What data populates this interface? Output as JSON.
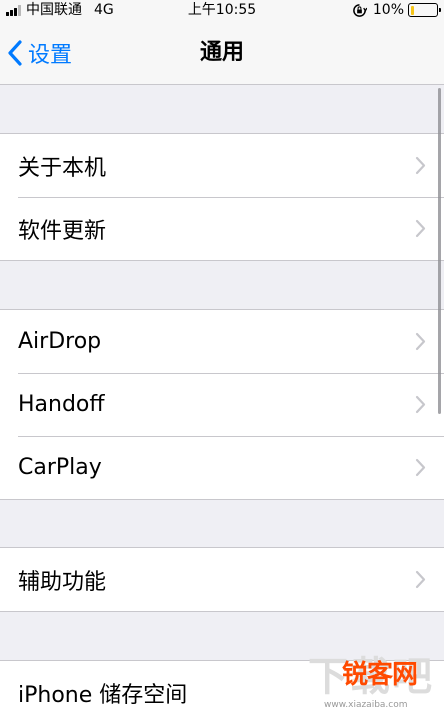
{
  "status_bar": {
    "carrier": "中国联通",
    "network": "4G",
    "time": "上午10:55",
    "battery": "10%",
    "battery_level": 0.1,
    "battery_color": "#f5c518"
  },
  "nav": {
    "back_label": "设置",
    "title": "通用",
    "accent": "#007aff"
  },
  "groups": [
    {
      "items": [
        {
          "label": "关于本机"
        },
        {
          "label": "软件更新"
        }
      ]
    },
    {
      "items": [
        {
          "label": "AirDrop"
        },
        {
          "label": "Handoff"
        },
        {
          "label": "CarPlay"
        }
      ]
    },
    {
      "items": [
        {
          "label": "辅助功能"
        }
      ]
    },
    {
      "items": [
        {
          "label": "iPhone 储存空间"
        }
      ]
    }
  ],
  "watermark": {
    "text": "锐客网",
    "bg_text": "下载吧",
    "sub_text": "www.xiazaiba.com"
  }
}
